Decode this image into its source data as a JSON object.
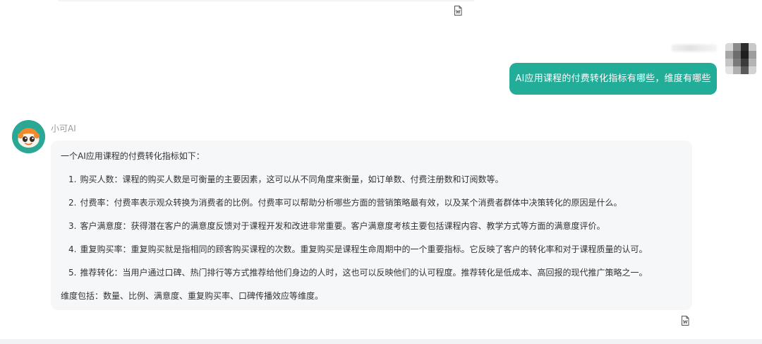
{
  "user_message": {
    "text": "AI应用课程的付费转化指标有哪些，维度有哪些"
  },
  "assistant": {
    "name": "小可AI",
    "intro": "一个AI应用课程的付费转化指标如下：",
    "items": [
      {
        "num": "1.",
        "text": "购买人数：课程的购买人数是可衡量的主要因素，这可以从不同角度来衡量，如订单数、付费注册数和订阅数等。"
      },
      {
        "num": "2.",
        "text": "付费率：付费率表示观众转换为消费者的比例。付费率可以帮助分析哪些方面的营销策略最有效，以及某个消费者群体中决策转化的原因是什么。"
      },
      {
        "num": "3.",
        "text": "客户满意度：获得潜在客户的满意度反馈对于课程开发和改进非常重要。客户满意度考核主要包括课程内容、教学方式等方面的满意度评价。"
      },
      {
        "num": "4.",
        "text": "重复购买率：重复购买就是指相同的顾客购买课程的次数。重复购买是课程生命周期中的一个重要指标。它反映了客户的转化率和对于课程质量的认可。"
      },
      {
        "num": "5.",
        "text": "推荐转化：当用户通过口碑、热门排行等方式推荐给他们身边的人时，这也可以反映他们的认可程度。推荐转化是低成本、高回报的现代推广策略之一。"
      }
    ],
    "summary": "维度包括：数量、比例、满意度、重复购买率、口碑传播效应等维度。"
  },
  "icons": {
    "copy_top": "document-icon",
    "copy_bottom": "document-icon"
  },
  "colors": {
    "user_bubble": "#21ad98",
    "bot_avatar": "#2aa894",
    "bot_bubble": "#f6f7f8"
  }
}
